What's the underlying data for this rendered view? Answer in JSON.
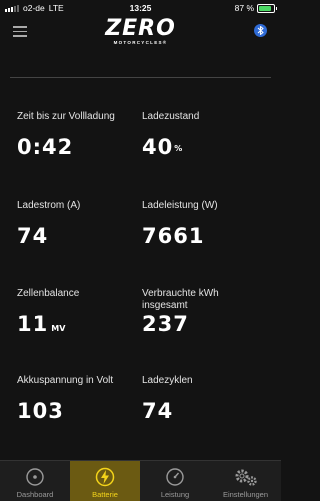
{
  "status": {
    "carrier": "o2-de",
    "network": "LTE",
    "time": "13:25",
    "battery": "87 %",
    "battery_level": 0.87
  },
  "header": {
    "logo": "ZERO",
    "logo_sub": "MOTORCYCLES®",
    "menu_icon": "hamburger-menu-icon",
    "bluetooth_icon": "bluetooth-icon"
  },
  "metrics": {
    "charge_time": {
      "label": "Zeit bis zur Vollladung",
      "value": "0:42"
    },
    "soc": {
      "label": "Ladezustand",
      "value": "40",
      "unit": "%"
    },
    "current": {
      "label": "Ladestrom (A)",
      "value": "74"
    },
    "power": {
      "label": "Ladeleistung (W)",
      "value": "7661"
    },
    "balance": {
      "label": "Zellenbalance",
      "value": "11",
      "unit": "MV"
    },
    "consumed": {
      "label": "Verbrauchte kWh insgesamt",
      "value": "237"
    },
    "voltage": {
      "label": "Akkuspannung in Volt",
      "value": "103"
    },
    "cycles": {
      "label": "Ladezyklen",
      "value": "74"
    }
  },
  "tabs": [
    {
      "label": "Dashboard",
      "icon": "gauge-circle-icon"
    },
    {
      "label": "Batterie",
      "icon": "battery-charging-icon"
    },
    {
      "label": "Leistung",
      "icon": "speedometer-icon"
    },
    {
      "label": "Einstellungen",
      "icon": "gears-icon"
    }
  ],
  "colors": {
    "background": "#131313",
    "accent": "#f4d41a",
    "active_tab": "#6b5a12",
    "bluetooth": "#2f6bd6",
    "battery_green": "#4cd964"
  }
}
